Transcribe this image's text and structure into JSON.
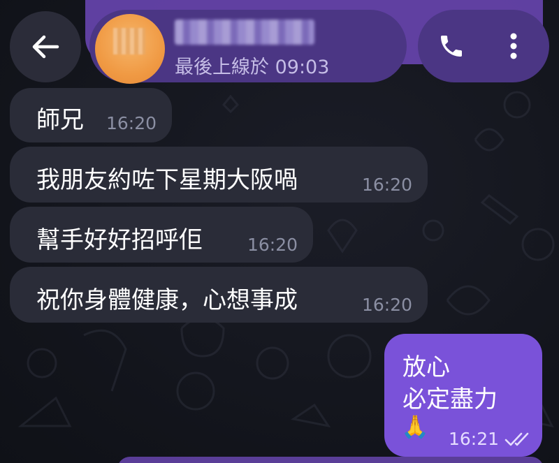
{
  "header": {
    "contact_name": "█████ ████",
    "last_seen": "最後上線於 09:03",
    "back_icon": "arrow-left-icon",
    "call_icon": "phone-icon",
    "menu_icon": "more-vertical-icon"
  },
  "messages": [
    {
      "direction": "in",
      "text": "師兄",
      "time": "16:20"
    },
    {
      "direction": "in",
      "text": "我朋友約咗下星期大阪喎",
      "time": "16:20"
    },
    {
      "direction": "in",
      "text": "幫手好好招呼佢",
      "time": "16:20"
    },
    {
      "direction": "in",
      "text": "祝你身體健康，心想事成",
      "time": "16:20"
    },
    {
      "direction": "out",
      "lines": [
        "放心",
        "必定盡力",
        "🙏"
      ],
      "time": "16:21",
      "status": "double-check-icon"
    }
  ],
  "colors": {
    "incoming_bubble": "#2a2c38",
    "outgoing_bubble": "#7a52d9",
    "header_pill": "#4b3684",
    "avatar": "#f09a44"
  }
}
